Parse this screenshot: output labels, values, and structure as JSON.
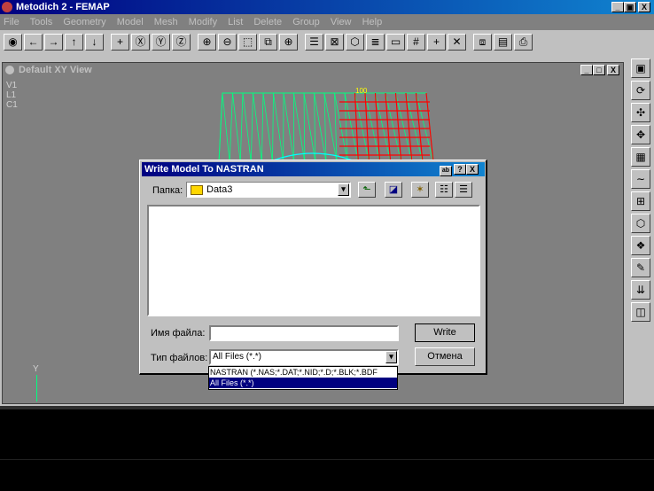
{
  "app": {
    "title": "Metodich 2 - FEMAP",
    "menu": [
      "File",
      "Tools",
      "Geometry",
      "Model",
      "Mesh",
      "Modify",
      "List",
      "Delete",
      "Group",
      "View",
      "Help"
    ],
    "caption_buttons": [
      "_",
      "▣",
      "X"
    ]
  },
  "toolbar": {
    "icons": [
      "camera-icon",
      "arrow-left-icon",
      "arrow-right-icon",
      "arrow-up-icon",
      "arrow-down-icon",
      "plus-icon",
      "rotate-x-icon",
      "rotate-y-icon",
      "rotate-z-icon",
      "zoom-in-icon",
      "zoom-out-icon",
      "zoom-box-icon",
      "zoom-fit-icon",
      "center-icon",
      "list-icon",
      "box-x-icon",
      "cube-icon",
      "layers-icon",
      "window-icon",
      "grid-icon",
      "cross-icon",
      "x-icon",
      "copy-icon",
      "clipboard-icon",
      "printer-icon"
    ],
    "glyphs": [
      "◉",
      "←",
      "→",
      "↑",
      "↓",
      "+",
      "Ⓧ",
      "Ⓨ",
      "Ⓩ",
      "⊕",
      "⊖",
      "⬚",
      "⧉",
      "⊕",
      "☰",
      "⊠",
      "⬡",
      "≣",
      "▭",
      "#",
      "+",
      "✕",
      "⧈",
      "▤",
      "⎙"
    ]
  },
  "view": {
    "title": "Default XY View",
    "labels": [
      "V1",
      "L1",
      "C1"
    ],
    "axis_y": "Y",
    "mesh_label": "100"
  },
  "right_toolbar": {
    "icons": [
      "save-icon",
      "rotate-icon",
      "node-icon",
      "element-icon",
      "mesh-icon",
      "curve-icon",
      "surface-icon",
      "solid-icon",
      "grid-3d-icon",
      "pen-icon",
      "load-icon",
      "window-icon"
    ],
    "glyphs": [
      "▣",
      "⟳",
      "✣",
      "✥",
      "▦",
      "∼",
      "⊞",
      "⬡",
      "❖",
      "✎",
      "⇊",
      "◫"
    ]
  },
  "dialog": {
    "title": "Write Model To NASTRAN",
    "folder_label": "Папка:",
    "folder_value": "Data3",
    "filename_label": "Имя файла:",
    "filename_value": "",
    "filetype_label": "Тип файлов:",
    "filetype_value": "All Files (*.*)",
    "write_button": "Write",
    "cancel_button": "Отмена",
    "dropdown_options": [
      "NASTRAN (*.NAS;*.DAT;*.NID;*.D;*.BLK;*.BDF",
      "All Files (*.*)"
    ],
    "selected_option_index": 1
  },
  "colors": {
    "desktop": "#008080",
    "window_bg": "#808080",
    "title_active": "#000080",
    "mesh_green": "#00ff80",
    "mesh_red": "#ff0000"
  }
}
